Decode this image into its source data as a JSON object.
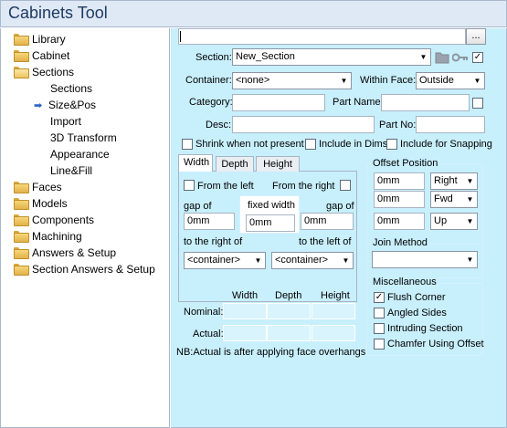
{
  "window": {
    "title": "Cabinets Tool"
  },
  "tree": {
    "items": [
      {
        "label": "Library",
        "icon": "folder-icon",
        "level": 0
      },
      {
        "label": "Cabinet",
        "icon": "folder-icon",
        "level": 0
      },
      {
        "label": "Sections",
        "icon": "folder-open-icon",
        "level": 0
      },
      {
        "label": "Sections",
        "icon": "",
        "level": 1
      },
      {
        "label": "Size&Pos",
        "icon": "arrow-right-icon",
        "level": 1,
        "selected": true
      },
      {
        "label": "Import",
        "icon": "",
        "level": 1
      },
      {
        "label": "3D Transform",
        "icon": "",
        "level": 1
      },
      {
        "label": "Appearance",
        "icon": "",
        "level": 1
      },
      {
        "label": "Line&Fill",
        "icon": "",
        "level": 1
      },
      {
        "label": "Faces",
        "icon": "folder-icon",
        "level": 0
      },
      {
        "label": "Models",
        "icon": "folder-icon",
        "level": 0
      },
      {
        "label": "Components",
        "icon": "folder-icon",
        "level": 0
      },
      {
        "label": "Machining",
        "icon": "folder-icon",
        "level": 0
      },
      {
        "label": "Answers & Setup",
        "icon": "folder-icon",
        "level": 0
      },
      {
        "label": "Section Answers & Setup",
        "icon": "folder-icon",
        "level": 0
      }
    ]
  },
  "toolbar": {
    "path_value": "",
    "browse_label": "..."
  },
  "section": {
    "label": "Section:",
    "value": "New_Section",
    "icons": [
      "folder-icon",
      "key-icon"
    ],
    "checked": true
  },
  "container": {
    "label": "Container:",
    "value": "<none>"
  },
  "within_face": {
    "label": "Within Face:",
    "value": "Outside"
  },
  "category": {
    "label": "Category:",
    "value": ""
  },
  "part_name": {
    "label": "Part Name:",
    "value": "",
    "checked": false
  },
  "desc": {
    "label": "Desc:",
    "value": ""
  },
  "part_no": {
    "label": "Part No:",
    "value": ""
  },
  "options": {
    "shrink": {
      "label": "Shrink when not present",
      "checked": false
    },
    "include_dims": {
      "label": "Include in Dims",
      "checked": false
    },
    "include_snapping": {
      "label": "Include for Snapping",
      "checked": false
    }
  },
  "tabs": [
    {
      "label": "Width",
      "active": true
    },
    {
      "label": "Depth",
      "active": false
    },
    {
      "label": "Height",
      "active": false
    }
  ],
  "width_tab": {
    "from_left_label": "From the left",
    "from_left_checked": false,
    "from_right_label": "From the right",
    "from_right_checked": false,
    "gap_left_label": "gap of",
    "gap_left_value": "0mm",
    "fixed_width_label": "fixed width",
    "fixed_width_value": "0mm",
    "gap_right_label": "gap of",
    "gap_right_value": "0mm",
    "right_of_label": "to the right of",
    "right_of_value": "<container>",
    "left_of_label": "to the left of",
    "left_of_value": "<container>"
  },
  "offset_position": {
    "title": "Offset Position",
    "rows": [
      {
        "value": "0mm",
        "option": "Right"
      },
      {
        "value": "0mm",
        "option": "Fwd"
      },
      {
        "value": "0mm",
        "option": "Up"
      }
    ]
  },
  "join_method": {
    "title": "Join Method",
    "value": ""
  },
  "miscellaneous": {
    "title": "Miscellaneous",
    "items": [
      {
        "label": "Flush Corner",
        "checked": true
      },
      {
        "label": "Angled Sides",
        "checked": false
      },
      {
        "label": "Intruding Section",
        "checked": false
      },
      {
        "label": "Chamfer Using Offset",
        "checked": false
      }
    ]
  },
  "dimensions": {
    "headers": [
      "Width",
      "Depth",
      "Height"
    ],
    "rows": [
      {
        "label": "Nominal:",
        "values": [
          "",
          "",
          ""
        ]
      },
      {
        "label": "Actual:",
        "values": [
          "",
          "",
          ""
        ]
      }
    ],
    "note": "NB:Actual is after applying face overhangs"
  }
}
